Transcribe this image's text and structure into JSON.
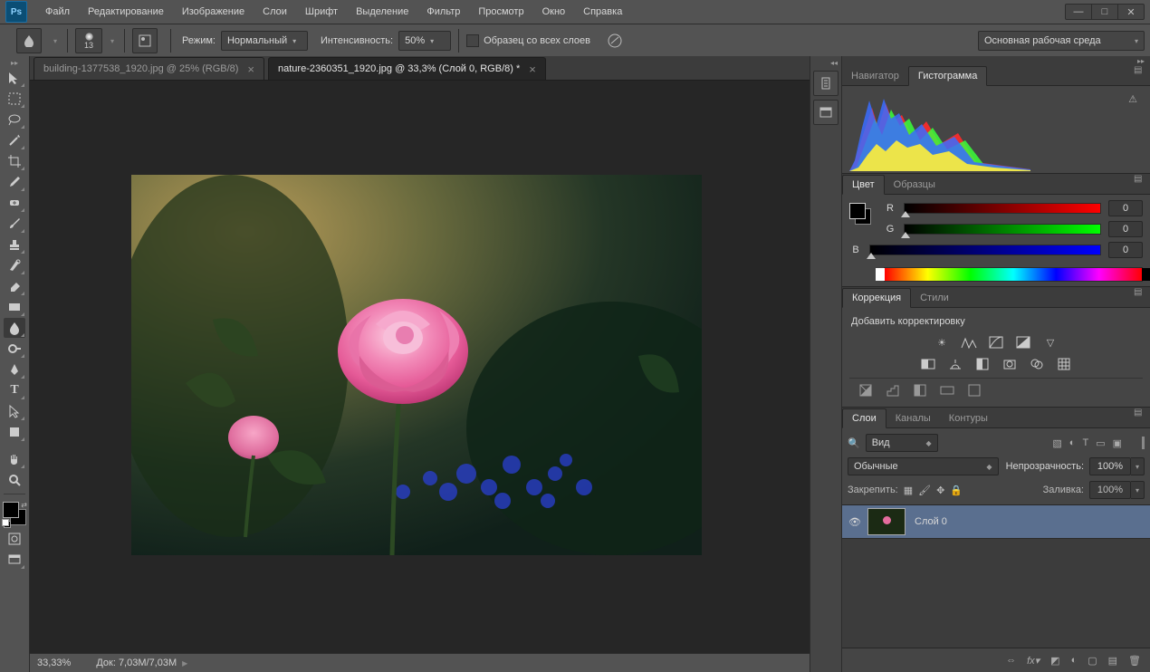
{
  "app": {
    "logo": "Ps"
  },
  "menu": [
    "Файл",
    "Редактирование",
    "Изображение",
    "Слои",
    "Шрифт",
    "Выделение",
    "Фильтр",
    "Просмотр",
    "Окно",
    "Справка"
  ],
  "optbar": {
    "brush_size": "13",
    "mode_label": "Режим:",
    "mode_value": "Нормальный",
    "intensity_label": "Интенсивность:",
    "intensity_value": "50%",
    "sample_all_label": "Образец со всех слоев",
    "workspace": "Основная рабочая среда"
  },
  "tabs": [
    {
      "label": "building-1377538_1920.jpg @ 25% (RGB/8)",
      "active": false
    },
    {
      "label": "nature-2360351_1920.jpg @ 33,3% (Слой 0, RGB/8) *",
      "active": true
    }
  ],
  "status": {
    "zoom": "33,33%",
    "doc_label": "Док:",
    "doc_value": "7,03M/7,03M"
  },
  "panels": {
    "nav_tab": "Навигатор",
    "histo_tab": "Гистограмма",
    "color_tab": "Цвет",
    "swatch_tab": "Образцы",
    "corr_tab": "Коррекция",
    "styles_tab": "Стили",
    "adj_title": "Добавить корректировку",
    "layers_tab": "Слои",
    "channels_tab": "Каналы",
    "paths_tab": "Контуры",
    "rgb": {
      "r_label": "R",
      "g_label": "G",
      "b_label": "B",
      "r": "0",
      "g": "0",
      "b": "0"
    },
    "layers": {
      "kind": "Вид",
      "blend": "Обычные",
      "opacity_label": "Непрозрачность:",
      "opacity": "100%",
      "lock_label": "Закрепить:",
      "fill_label": "Заливка:",
      "fill": "100%",
      "items": [
        {
          "name": "Слой 0"
        }
      ]
    }
  }
}
